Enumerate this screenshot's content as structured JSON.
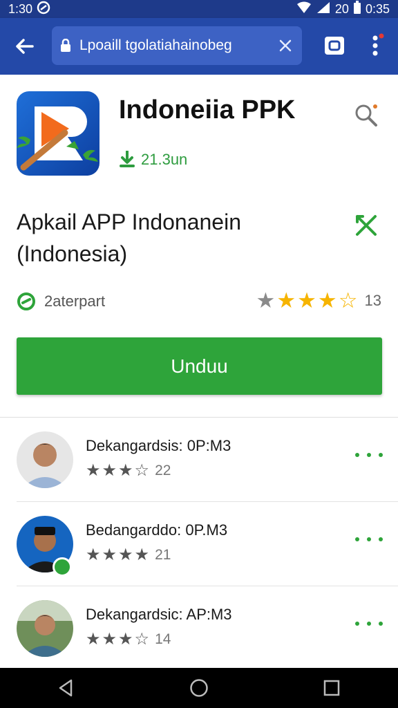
{
  "status_bar": {
    "time": "1:30",
    "right_label": "20",
    "battery_time": "0:35"
  },
  "browser": {
    "url": "Lpoaill tgolatiahainobeg"
  },
  "app": {
    "name": "Indoneiia PPK",
    "downloads": "21.3un",
    "subtitle": "Apkail APP Indonanein (Indonesia)",
    "developer": "2aterpart",
    "rating_stars": 3.5,
    "rating_count": "13",
    "download_label": "Unduu"
  },
  "reviews": [
    {
      "name": "Dekangardsis: 0P:M3",
      "stars": 3,
      "count": "22"
    },
    {
      "name": "Bedangarddo: 0P.M3",
      "stars": 4,
      "count": "21"
    },
    {
      "name": "Dekangardsic: AP:M3",
      "stars": 3,
      "count": "14"
    }
  ],
  "colors": {
    "toolbar": "#2449a8",
    "status_bar": "#1e3a8a",
    "accent_green": "#2ea43a",
    "star": "#f6b400"
  },
  "icons": [
    "back-arrow-icon",
    "lock-icon",
    "close-icon",
    "tabs-icon",
    "more-vert-icon",
    "search-icon",
    "download-icon",
    "share-icon",
    "verified-icon",
    "star-icon",
    "more-horiz-icon",
    "nav-back-icon",
    "nav-home-icon",
    "nav-recents-icon"
  ]
}
